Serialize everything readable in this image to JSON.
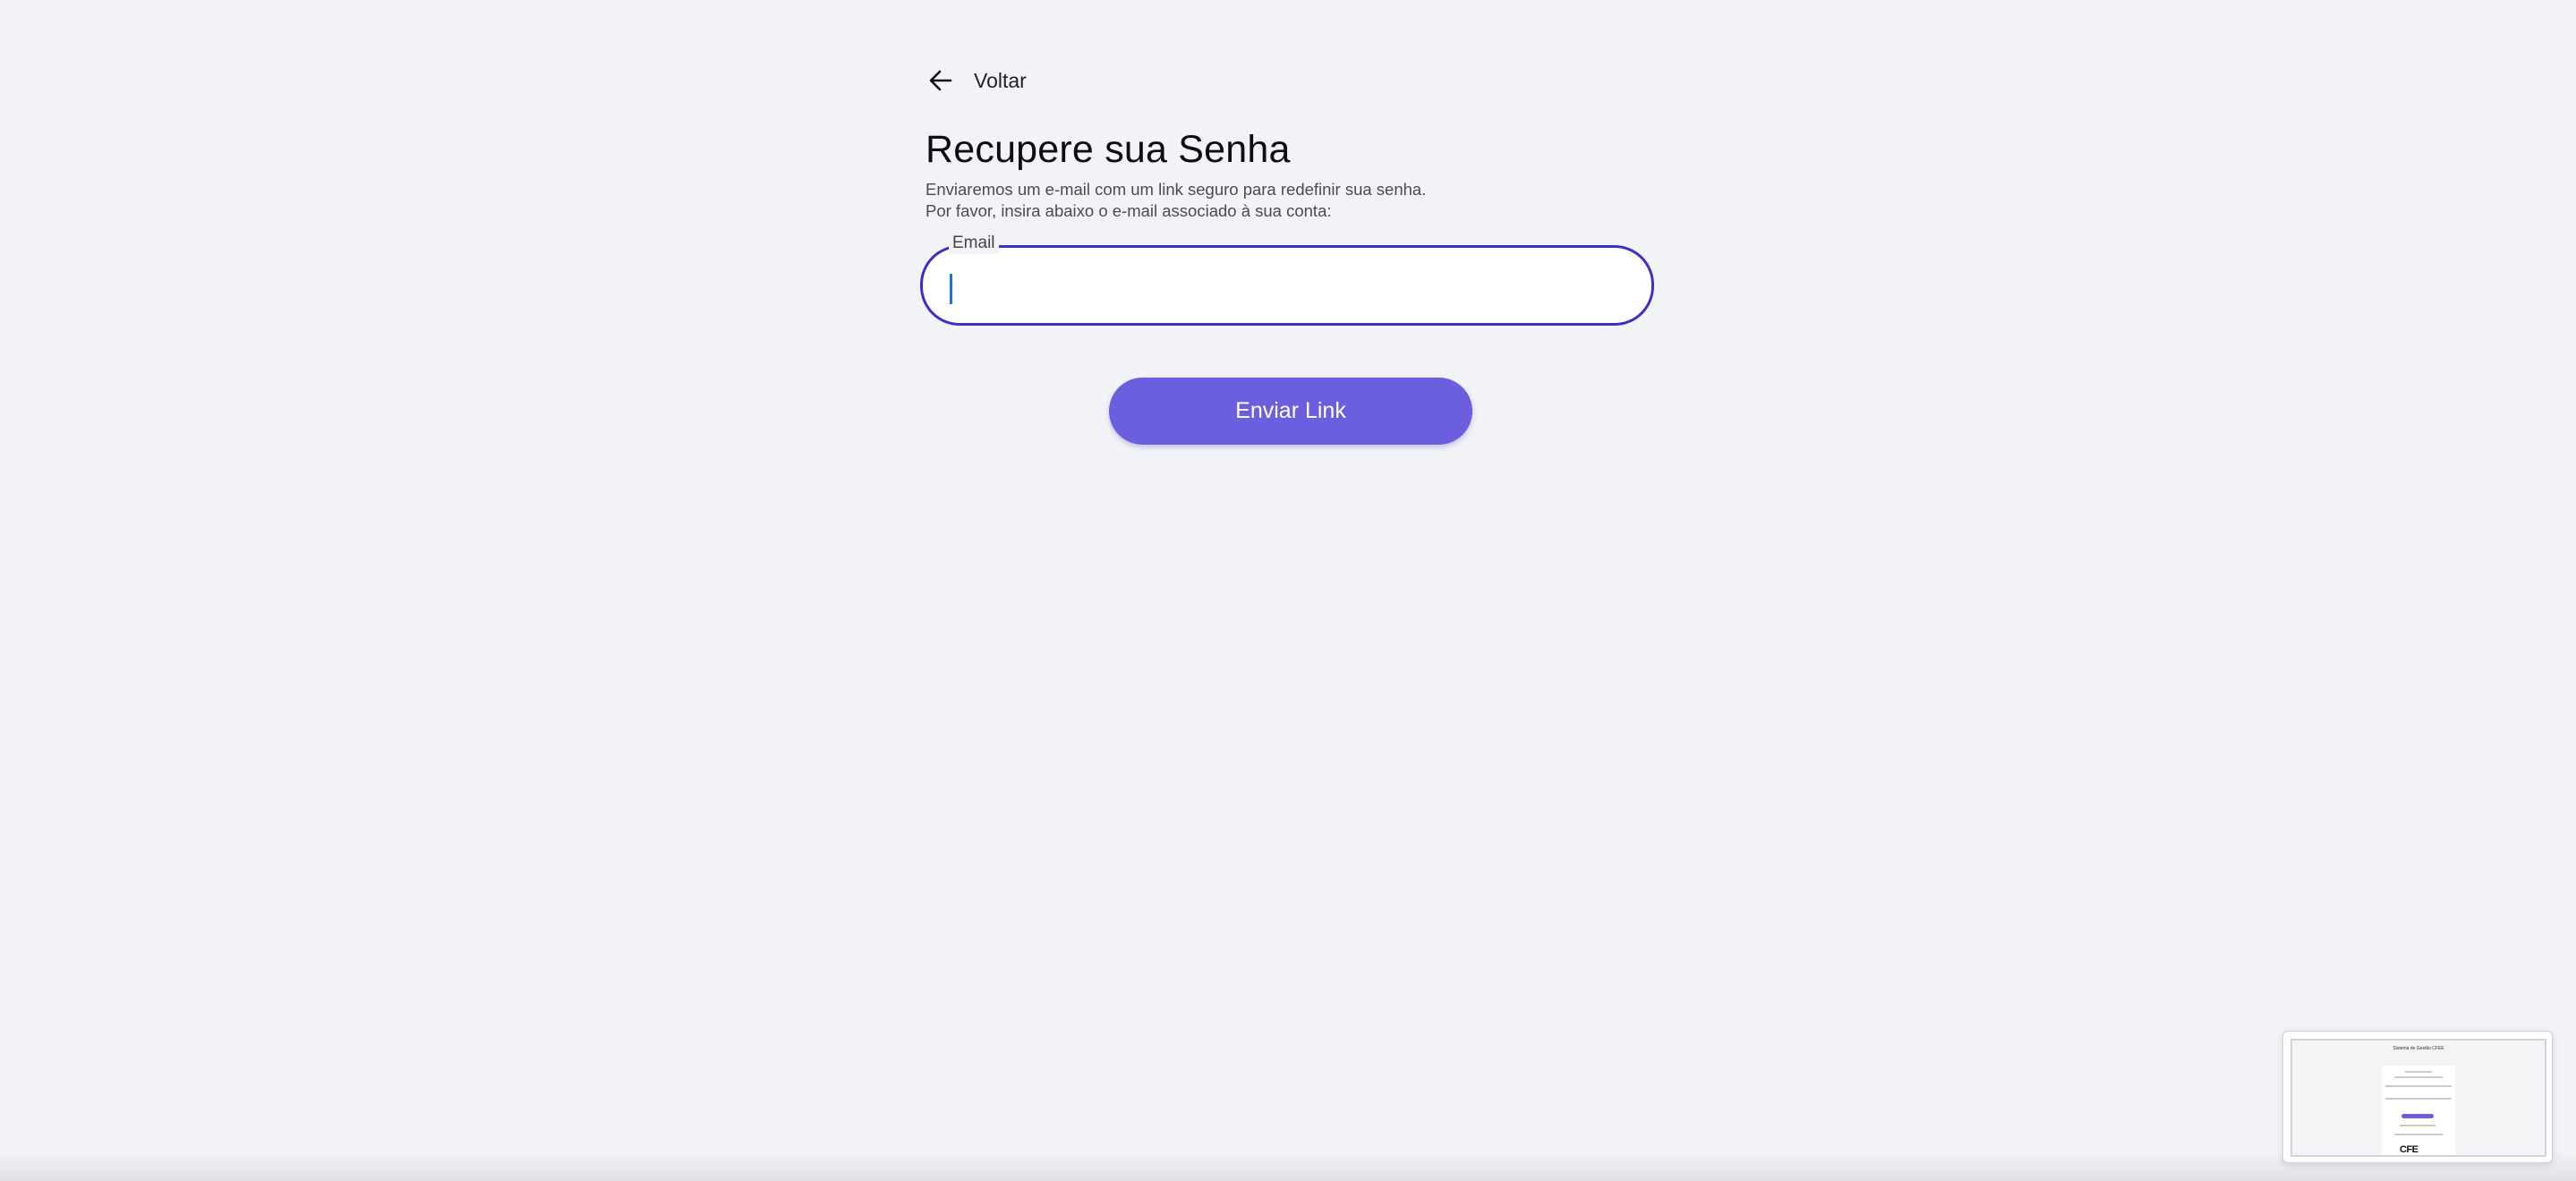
{
  "back": {
    "label": "Voltar",
    "icon": "arrow-left-icon"
  },
  "header": {
    "title": "Recupere sua Senha",
    "subtitle_line1": "Enviaremos um e-mail com um link seguro para redefinir sua senha.",
    "subtitle_line2": "Por favor, insira abaixo o e-mail associado à sua conta:"
  },
  "form": {
    "email_label": "Email",
    "email_value": "",
    "submit_label": "Enviar Link"
  },
  "preview": {
    "title": "Sistema de Gestão CFEE",
    "logo_text": "CFE"
  },
  "colors": {
    "accent": "#6b5fdf",
    "focus_border": "#3a2fc8",
    "background": "#f2f3f7"
  }
}
